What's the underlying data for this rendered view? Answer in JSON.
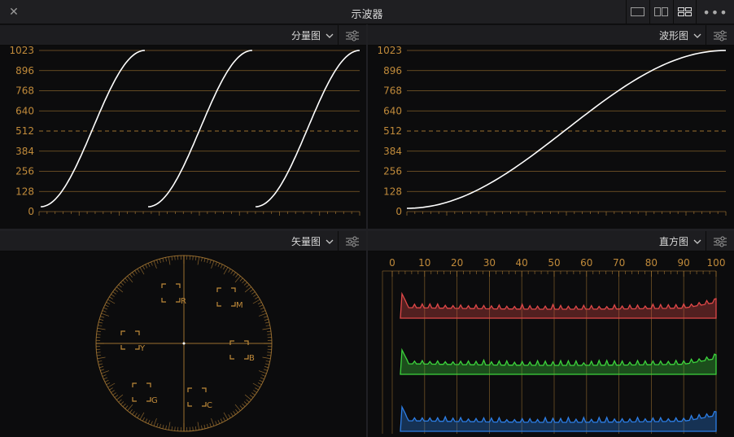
{
  "window": {
    "title": "示波器",
    "close_glyph": "✕",
    "more_glyph": "•••"
  },
  "layout_buttons": [
    "single-view-icon",
    "dual-view-icon",
    "quad-view-icon"
  ],
  "colors": {
    "grid": "#c08a3a",
    "trace": "#ffffff",
    "red": "#e04848",
    "green": "#3cd43c",
    "blue": "#2c7ee6"
  },
  "panels": {
    "parade": {
      "mode_label": "分量图",
      "y_ticks": [
        "1023",
        "896",
        "768",
        "640",
        "512",
        "384",
        "256",
        "128",
        "0"
      ]
    },
    "waveform": {
      "mode_label": "波形图",
      "y_ticks": [
        "1023",
        "896",
        "768",
        "640",
        "512",
        "384",
        "256",
        "128",
        "0"
      ]
    },
    "vectorscope": {
      "mode_label": "矢量图",
      "targets": [
        "R",
        "M",
        "B",
        "C",
        "G",
        "Y"
      ]
    },
    "histogram": {
      "mode_label": "直方图",
      "x_ticks": [
        "0",
        "10",
        "20",
        "30",
        "40",
        "50",
        "60",
        "70",
        "80",
        "90",
        "100"
      ]
    }
  }
}
